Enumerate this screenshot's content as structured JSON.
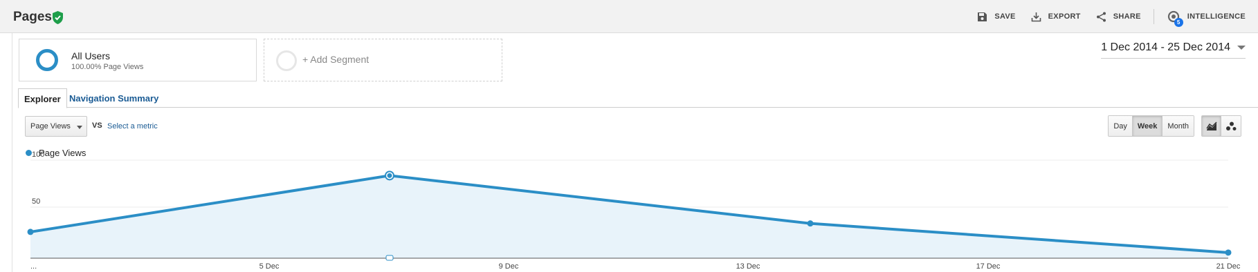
{
  "header": {
    "title": "Pages",
    "actions": [
      {
        "label": "SAVE",
        "icon": "save-icon"
      },
      {
        "label": "EXPORT",
        "icon": "export-icon"
      },
      {
        "label": "SHARE",
        "icon": "share-icon"
      },
      {
        "label": "INTELLIGENCE",
        "icon": "intelligence-icon",
        "badge": "5"
      }
    ]
  },
  "segments": {
    "all_users": {
      "name": "All Users",
      "sub": "100.00% Page Views"
    },
    "add_label": "+ Add Segment"
  },
  "date_range": "1 Dec 2014 - 25 Dec 2014",
  "tabs": [
    "Explorer",
    "Navigation Summary"
  ],
  "controls": {
    "metric": "Page Views",
    "vs": "VS",
    "select_metric": "Select a metric",
    "periods": [
      "Day",
      "Week",
      "Month"
    ],
    "active_period": "Week"
  },
  "colors": {
    "accent": "#2b8ec6",
    "fill": "#e8f3fa",
    "link": "#1a5b94"
  },
  "chart_data": {
    "type": "area",
    "series": [
      {
        "name": "Page Views",
        "x": [
          "30 Nov",
          "7 Dec",
          "14 Dec",
          "21 Dec"
        ],
        "values": [
          28,
          88,
          37,
          6
        ]
      }
    ],
    "x_tick_labels": [
      "...",
      "5 Dec",
      "9 Dec",
      "13 Dec",
      "17 Dec",
      "21 Dec"
    ],
    "y_tick_labels": [
      "100",
      "50"
    ],
    "ylim": [
      0,
      100
    ],
    "grid": true,
    "legend": "top-left"
  }
}
